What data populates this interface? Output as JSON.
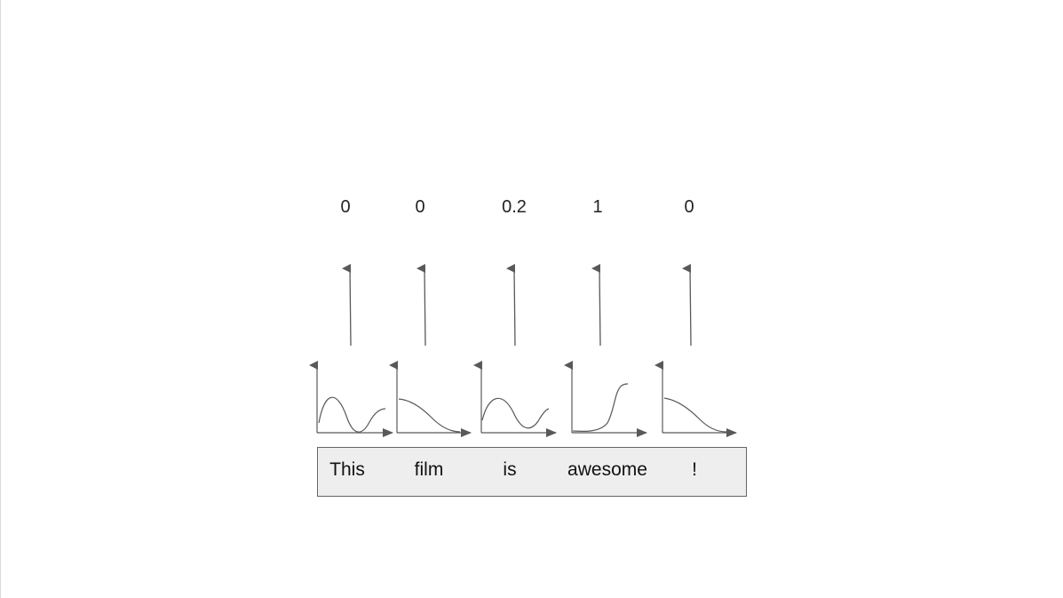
{
  "diagram": {
    "scores": [
      "0",
      "0",
      "0.2",
      "1",
      "0"
    ],
    "tokens": [
      "This",
      "film",
      "is",
      "awesome",
      "!"
    ],
    "plot_icons": [
      "bimodal-curve-icon",
      "decay-curve-icon",
      "bimodal-curve-icon",
      "sigmoid-curve-icon",
      "decay-curve-icon"
    ],
    "colors": {
      "stroke": "#595959",
      "box_fill": "#eeeeee",
      "box_border": "#666666",
      "text": "#111111"
    }
  }
}
